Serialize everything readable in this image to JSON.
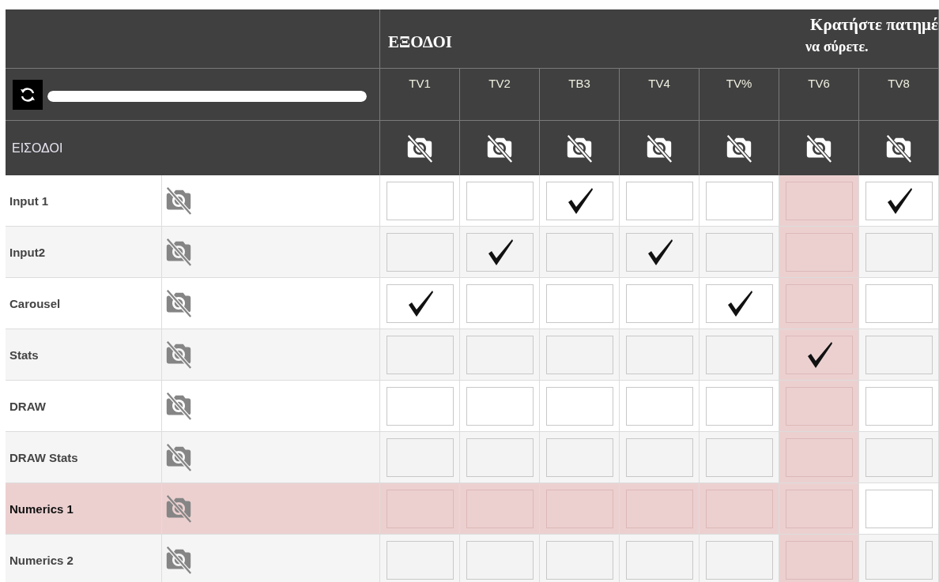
{
  "header": {
    "title": "ΕΞΟΔΟΙ",
    "hint_line_1": "Κρατήστε πατημέ",
    "hint_line_2": "να σύρετε.",
    "inputs_label": "ΕΙΣΟΔΟΙ",
    "slider": {
      "level": 1
    }
  },
  "columns": [
    {
      "label": "TV1"
    },
    {
      "label": "TV2"
    },
    {
      "label": "TB3"
    },
    {
      "label": "TV4"
    },
    {
      "label": "TV%"
    },
    {
      "label": "TV6"
    },
    {
      "label": "TV8"
    }
  ],
  "rows": [
    {
      "label": "Input 1",
      "highlighted": false,
      "checked": [
        false,
        false,
        true,
        false,
        false,
        false,
        true
      ],
      "cells_highlighted": [
        false,
        false,
        false,
        false,
        false,
        true,
        false
      ]
    },
    {
      "label": "Input2",
      "highlighted": false,
      "checked": [
        false,
        true,
        false,
        true,
        false,
        false,
        false
      ],
      "cells_highlighted": [
        false,
        false,
        false,
        false,
        false,
        true,
        false
      ]
    },
    {
      "label": "Carousel",
      "highlighted": false,
      "checked": [
        true,
        false,
        false,
        false,
        true,
        false,
        false
      ],
      "cells_highlighted": [
        false,
        false,
        false,
        false,
        false,
        true,
        false
      ]
    },
    {
      "label": "Stats",
      "highlighted": false,
      "checked": [
        false,
        false,
        false,
        false,
        false,
        true,
        false
      ],
      "cells_highlighted": [
        false,
        false,
        false,
        false,
        false,
        true,
        false
      ]
    },
    {
      "label": "DRAW",
      "highlighted": false,
      "checked": [
        false,
        false,
        false,
        false,
        false,
        false,
        false
      ],
      "cells_highlighted": [
        false,
        false,
        false,
        false,
        false,
        true,
        false
      ]
    },
    {
      "label": "DRAW Stats",
      "highlighted": false,
      "checked": [
        false,
        false,
        false,
        false,
        false,
        false,
        false
      ],
      "cells_highlighted": [
        false,
        false,
        false,
        false,
        false,
        true,
        false
      ]
    },
    {
      "label": "Numerics 1",
      "highlighted": true,
      "checked": [
        false,
        false,
        false,
        false,
        false,
        false,
        false
      ],
      "cells_highlighted": [
        true,
        true,
        true,
        true,
        true,
        true,
        false
      ]
    },
    {
      "label": "Numerics 2",
      "highlighted": false,
      "checked": [
        false,
        false,
        false,
        false,
        false,
        false,
        false
      ],
      "cells_highlighted": [
        false,
        false,
        false,
        false,
        false,
        true,
        false
      ]
    }
  ]
}
